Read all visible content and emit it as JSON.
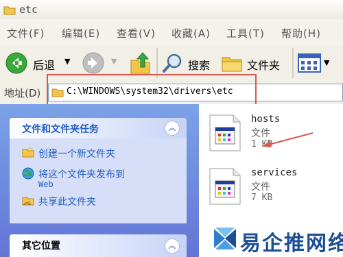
{
  "window": {
    "title": "etc"
  },
  "menu": [
    "文件(F)",
    "编辑(E)",
    "查看(V)",
    "收藏(A)",
    "工具(T)",
    "帮助(H)"
  ],
  "toolbar": {
    "back_label": "后退",
    "search_label": "搜索",
    "folders_label": "文件夹"
  },
  "address": {
    "label": "地址(D)",
    "path": "C:\\WINDOWS\\system32\\drivers\\etc"
  },
  "tasks": {
    "title": "文件和文件夹任务",
    "collapse_glyph": "︽",
    "items": [
      {
        "label": "创建一个新文件夹"
      },
      {
        "label": "将这个文件夹发布到",
        "label2": "Web"
      },
      {
        "label": "共享此文件夹"
      }
    ]
  },
  "other_places": {
    "title": "其它位置",
    "collapse_glyph": "︽"
  },
  "files": [
    {
      "name": "hosts",
      "type": "文件",
      "size": "1 KB"
    },
    {
      "name": "services",
      "type": "文件",
      "size": "7 KB"
    }
  ],
  "watermark": {
    "text": "易企推网络"
  },
  "colors": {
    "accent": "#215dc6",
    "annotation": "#d8584f",
    "pane": "#7ba2e7"
  }
}
